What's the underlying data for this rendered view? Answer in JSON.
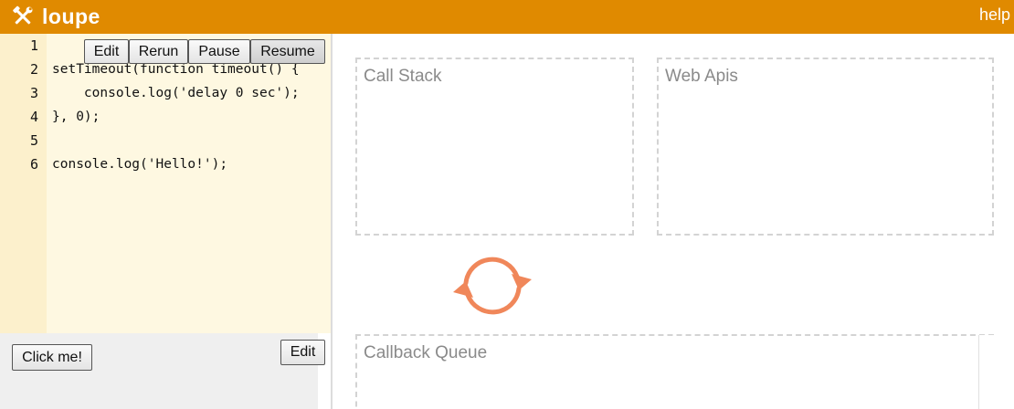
{
  "header": {
    "logo_icon": "hammer-wrench-icon",
    "app_name": "loupe",
    "help_label": "help",
    "background_color": "#e08a00"
  },
  "editor": {
    "line_numbers": [
      "1",
      "2",
      "3",
      "4",
      "5",
      "6"
    ],
    "code_lines": [
      "",
      "setTimeout(function timeout() {",
      "    console.log('delay 0 sec');",
      "}, 0);",
      "",
      "console.log('Hello!');"
    ],
    "toolbar": {
      "edit_label": "Edit",
      "rerun_label": "Rerun",
      "pause_label": "Pause",
      "resume_label": "Resume"
    }
  },
  "preview": {
    "click_button_label": "Click me!",
    "edit_label": "Edit"
  },
  "runtime": {
    "call_stack_title": "Call Stack",
    "web_apis_title": "Web Apis",
    "callback_queue_title": "Callback Queue",
    "event_loop_icon": "refresh-cycle-icon",
    "event_loop_color": "#f0875a"
  }
}
